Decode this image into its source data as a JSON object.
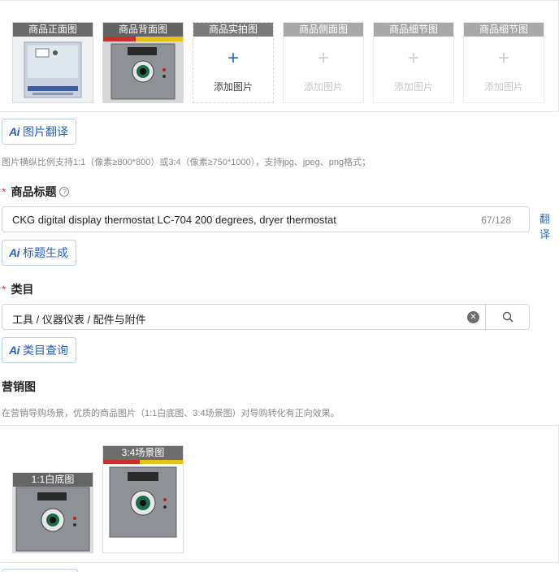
{
  "image_slots": [
    {
      "label": "商品正面图",
      "state": "filled"
    },
    {
      "label": "商品背面图",
      "state": "filled"
    },
    {
      "label": "商品实拍图",
      "state": "empty",
      "add_text": "添加图片"
    },
    {
      "label": "商品侧面图",
      "state": "disabled",
      "add_text": "添加图片"
    },
    {
      "label": "商品细节图",
      "state": "disabled",
      "add_text": "添加图片"
    },
    {
      "label": "商品细节图",
      "state": "disabled",
      "add_text": "添加图片"
    }
  ],
  "ai_mark": "Ai",
  "image_translate_label": "图片翻译",
  "image_hint": "图片横纵比例支持1:1（像素≥800*800）或3:4（像素≥750*1000），支持jpg、jpeg、png格式；",
  "title_section": {
    "required_mark": "*",
    "label": "商品标题",
    "help_icon": "?",
    "value": "CKG digital display thermostat LC-704 200 degrees, dryer thermostat",
    "count": "67/128",
    "translate": "翻译",
    "generate_label": "标题生成"
  },
  "category_section": {
    "required_mark": "*",
    "label": "类目",
    "value": "工具 / 仪器仪表 / 配件与附件",
    "query_label": "类目查询"
  },
  "marketing_section": {
    "label": "营销图",
    "hint": "在营销导购场景，优质的商品图片（1:1白底图、3:4场景图）对导购转化有正向效果。",
    "slots": [
      {
        "label": "1:1白底图"
      },
      {
        "label": "3:4场景图"
      }
    ]
  },
  "colors": {
    "accent": "#2a5fbf",
    "required": "#e53935",
    "link": "#2a6fd0"
  }
}
